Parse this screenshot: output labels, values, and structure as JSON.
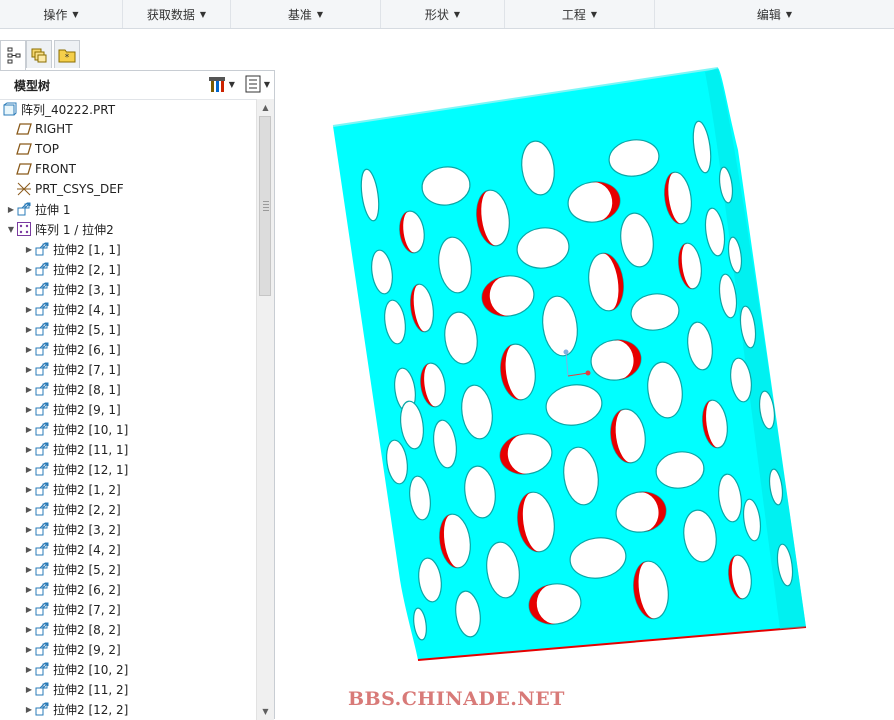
{
  "ribbon": {
    "groups": [
      {
        "label": "操作"
      },
      {
        "label": "获取数据"
      },
      {
        "label": "基准"
      },
      {
        "label": "形状"
      },
      {
        "label": "工程"
      },
      {
        "label": "编辑"
      }
    ]
  },
  "navigator": {
    "tabs": [
      "model-tree-icon",
      "layer-tree-icon",
      "favorites-folder-icon"
    ]
  },
  "model_tree": {
    "title": "模型树",
    "items": [
      {
        "label": "阵列_40222.PRT",
        "icon": "part-icon",
        "indent": 0,
        "expander": ""
      },
      {
        "label": "RIGHT",
        "icon": "datum-plane-icon",
        "indent": 1,
        "expander": ""
      },
      {
        "label": "TOP",
        "icon": "datum-plane-icon",
        "indent": 1,
        "expander": ""
      },
      {
        "label": "FRONT",
        "icon": "datum-plane-icon",
        "indent": 1,
        "expander": ""
      },
      {
        "label": "PRT_CSYS_DEF",
        "icon": "csys-icon",
        "indent": 1,
        "expander": ""
      },
      {
        "label": "拉伸 1",
        "icon": "extrude-icon",
        "indent": 1,
        "expander": "▶"
      },
      {
        "label": "阵列 1 / 拉伸2",
        "icon": "pattern-icon",
        "indent": 1,
        "expander": "▼"
      },
      {
        "label": "拉伸2 [1, 1]",
        "icon": "extrude-icon",
        "indent": 2,
        "expander": "▶"
      },
      {
        "label": "拉伸2 [2, 1]",
        "icon": "extrude-icon",
        "indent": 2,
        "expander": "▶"
      },
      {
        "label": "拉伸2 [3, 1]",
        "icon": "extrude-icon",
        "indent": 2,
        "expander": "▶"
      },
      {
        "label": "拉伸2 [4, 1]",
        "icon": "extrude-icon",
        "indent": 2,
        "expander": "▶"
      },
      {
        "label": "拉伸2 [5, 1]",
        "icon": "extrude-icon",
        "indent": 2,
        "expander": "▶"
      },
      {
        "label": "拉伸2 [6, 1]",
        "icon": "extrude-icon",
        "indent": 2,
        "expander": "▶"
      },
      {
        "label": "拉伸2 [7, 1]",
        "icon": "extrude-icon",
        "indent": 2,
        "expander": "▶"
      },
      {
        "label": "拉伸2 [8, 1]",
        "icon": "extrude-icon",
        "indent": 2,
        "expander": "▶"
      },
      {
        "label": "拉伸2 [9, 1]",
        "icon": "extrude-icon",
        "indent": 2,
        "expander": "▶"
      },
      {
        "label": "拉伸2 [10, 1]",
        "icon": "extrude-icon",
        "indent": 2,
        "expander": "▶"
      },
      {
        "label": "拉伸2 [11, 1]",
        "icon": "extrude-icon",
        "indent": 2,
        "expander": "▶"
      },
      {
        "label": "拉伸2 [12, 1]",
        "icon": "extrude-icon",
        "indent": 2,
        "expander": "▶"
      },
      {
        "label": "拉伸2 [1, 2]",
        "icon": "extrude-icon",
        "indent": 2,
        "expander": "▶"
      },
      {
        "label": "拉伸2 [2, 2]",
        "icon": "extrude-icon",
        "indent": 2,
        "expander": "▶"
      },
      {
        "label": "拉伸2 [3, 2]",
        "icon": "extrude-icon",
        "indent": 2,
        "expander": "▶"
      },
      {
        "label": "拉伸2 [4, 2]",
        "icon": "extrude-icon",
        "indent": 2,
        "expander": "▶"
      },
      {
        "label": "拉伸2 [5, 2]",
        "icon": "extrude-icon",
        "indent": 2,
        "expander": "▶"
      },
      {
        "label": "拉伸2 [6, 2]",
        "icon": "extrude-icon",
        "indent": 2,
        "expander": "▶"
      },
      {
        "label": "拉伸2 [7, 2]",
        "icon": "extrude-icon",
        "indent": 2,
        "expander": "▶"
      },
      {
        "label": "拉伸2 [8, 2]",
        "icon": "extrude-icon",
        "indent": 2,
        "expander": "▶"
      },
      {
        "label": "拉伸2 [9, 2]",
        "icon": "extrude-icon",
        "indent": 2,
        "expander": "▶"
      },
      {
        "label": "拉伸2 [10, 2]",
        "icon": "extrude-icon",
        "indent": 2,
        "expander": "▶"
      },
      {
        "label": "拉伸2 [11, 2]",
        "icon": "extrude-icon",
        "indent": 2,
        "expander": "▶"
      },
      {
        "label": "拉伸2 [12, 2]",
        "icon": "extrude-icon",
        "indent": 2,
        "expander": "▶"
      }
    ]
  },
  "viewport": {
    "model_color": "#00ffff",
    "cut_color": "#e60000",
    "watermark": "BBS.CHINADE.NET"
  }
}
